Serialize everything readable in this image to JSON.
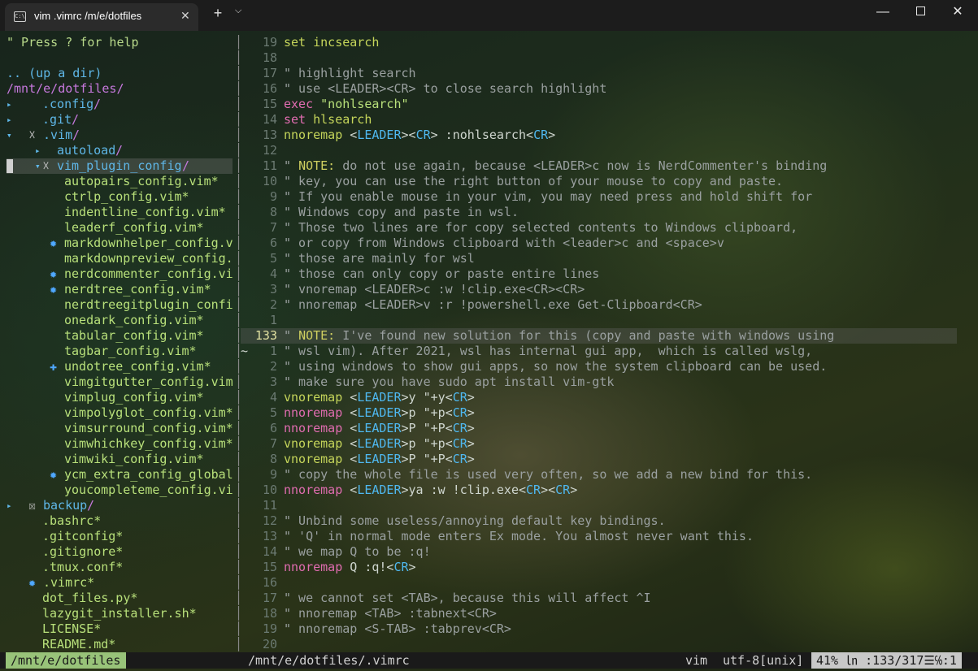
{
  "window": {
    "tab_title": "vim .vimrc /m/e/dotfiles",
    "tab_icon_text": "C:\\",
    "tab_close": "✕",
    "new_tab": "+",
    "dropdown": "⌵",
    "minimize": "—",
    "close": "✕"
  },
  "tree": {
    "help": "\" Press ? for help",
    "updir": ".. (up a dir)",
    "root": "/mnt/e/dotfiles/",
    "rows": [
      {
        "indent": 0,
        "arrow": "▸",
        "mark": "",
        "name": ".config",
        "dir": true
      },
      {
        "indent": 0,
        "arrow": "▸",
        "mark": "",
        "name": ".git",
        "dir": true
      },
      {
        "indent": 0,
        "arrow": "▾",
        "mark": "☓",
        "name": ".vim",
        "dir": true
      },
      {
        "indent": 1,
        "arrow": "▸",
        "mark": "",
        "name": "autoload",
        "dir": true
      },
      {
        "indent": 1,
        "arrow": "▾",
        "mark": "☓",
        "name": "vim_plugin_config",
        "dir": true,
        "selected": true
      },
      {
        "indent": 2,
        "mark": "",
        "name": "autopairs_config.vim*"
      },
      {
        "indent": 2,
        "mark": "",
        "name": "ctrlp_config.vim*"
      },
      {
        "indent": 2,
        "mark": "",
        "name": "indentline_config.vim*"
      },
      {
        "indent": 2,
        "mark": "",
        "name": "leaderf_config.vim*"
      },
      {
        "indent": 2,
        "mark": "✹",
        "name": "markdownhelper_config.v"
      },
      {
        "indent": 2,
        "mark": "",
        "name": "markdownpreview_config."
      },
      {
        "indent": 2,
        "mark": "✹",
        "name": "nerdcommenter_config.vi"
      },
      {
        "indent": 2,
        "mark": "✹",
        "name": "nerdtree_config.vim*"
      },
      {
        "indent": 2,
        "mark": "",
        "name": "nerdtreegitplugin_confi"
      },
      {
        "indent": 2,
        "mark": "",
        "name": "onedark_config.vim*"
      },
      {
        "indent": 2,
        "mark": "",
        "name": "tabular_config.vim*"
      },
      {
        "indent": 2,
        "mark": "",
        "name": "tagbar_config.vim*"
      },
      {
        "indent": 2,
        "mark": "✚",
        "name": "undotree_config.vim*"
      },
      {
        "indent": 2,
        "mark": "",
        "name": "vimgitgutter_config.vim"
      },
      {
        "indent": 2,
        "mark": "",
        "name": "vimplug_config.vim*"
      },
      {
        "indent": 2,
        "mark": "",
        "name": "vimpolyglot_config.vim*"
      },
      {
        "indent": 2,
        "mark": "",
        "name": "vimsurround_config.vim*"
      },
      {
        "indent": 2,
        "mark": "",
        "name": "vimwhichkey_config.vim*"
      },
      {
        "indent": 2,
        "mark": "",
        "name": "vimwiki_config.vim*"
      },
      {
        "indent": 2,
        "mark": "✹",
        "name": "ycm_extra_config_global"
      },
      {
        "indent": 2,
        "mark": "",
        "name": "youcompleteme_config.vi"
      },
      {
        "indent": 0,
        "arrow": "▸",
        "mark": "☒",
        "name": "backup",
        "dir": true
      },
      {
        "indent": 0,
        "mark": "",
        "name": ".bashrc*"
      },
      {
        "indent": 0,
        "mark": "",
        "name": ".gitconfig*"
      },
      {
        "indent": 0,
        "mark": "",
        "name": ".gitignore*"
      },
      {
        "indent": 0,
        "mark": "",
        "name": ".tmux.conf*"
      },
      {
        "indent": 0,
        "mark": "✹",
        "name": ".vimrc*"
      },
      {
        "indent": 0,
        "mark": "",
        "name": "dot_files.py*"
      },
      {
        "indent": 0,
        "mark": "",
        "name": "lazygit_installer.sh*"
      },
      {
        "indent": 0,
        "mark": "",
        "name": "LICENSE*"
      },
      {
        "indent": 0,
        "mark": "",
        "name": "README.md*"
      }
    ]
  },
  "editor": {
    "sign_tilde": "~",
    "lines": [
      {
        "n": "19",
        "tokens": [
          [
            "kw2",
            "set"
          ],
          [
            "plain",
            " "
          ],
          [
            "kw2",
            "incsearch"
          ]
        ]
      },
      {
        "n": "18",
        "tokens": []
      },
      {
        "n": "17",
        "tokens": [
          [
            "cmt",
            "\" highlight search"
          ]
        ]
      },
      {
        "n": "16",
        "tokens": [
          [
            "cmt",
            "\" use <LEADER><CR> to close search highlight"
          ]
        ]
      },
      {
        "n": "15",
        "tokens": [
          [
            "kw",
            "exec"
          ],
          [
            "plain",
            " "
          ],
          [
            "str",
            "\"nohlsearch\""
          ]
        ]
      },
      {
        "n": "14",
        "tokens": [
          [
            "kw",
            "set"
          ],
          [
            "plain",
            " "
          ],
          [
            "kw2",
            "hlsearch"
          ]
        ]
      },
      {
        "n": "13",
        "tokens": [
          [
            "kw2",
            "nnoremap"
          ],
          [
            "plain",
            " <"
          ],
          [
            "key",
            "LEADER"
          ],
          [
            "plain",
            "><"
          ],
          [
            "key",
            "CR"
          ],
          [
            "plain",
            "> :nohlsearch<"
          ],
          [
            "key",
            "CR"
          ],
          [
            "plain",
            ">"
          ]
        ]
      },
      {
        "n": "12",
        "tokens": []
      },
      {
        "n": "11",
        "tokens": [
          [
            "cmt",
            "\" "
          ],
          [
            "cmtnote",
            "NOTE:"
          ],
          [
            "cmt",
            " do not use again, because <LEADER>c now is NerdCommenter's binding"
          ]
        ]
      },
      {
        "n": "10",
        "tokens": [
          [
            "cmt",
            "\" key, you can use the right button of your mouse to copy and paste."
          ]
        ]
      },
      {
        "n": "9",
        "tokens": [
          [
            "cmt",
            "\" If you enable mouse in your vim, you may need press and hold shift for"
          ]
        ]
      },
      {
        "n": "8",
        "tokens": [
          [
            "cmt",
            "\" Windows copy and paste in wsl."
          ]
        ]
      },
      {
        "n": "7",
        "tokens": [
          [
            "cmt",
            "\" Those two lines are for copy selected contents to Windows clipboard,"
          ]
        ]
      },
      {
        "n": "6",
        "tokens": [
          [
            "cmt",
            "\" or copy from Windows clipboard with <leader>c and <space>v"
          ]
        ]
      },
      {
        "n": "5",
        "tokens": [
          [
            "cmt",
            "\" those are mainly for wsl"
          ]
        ]
      },
      {
        "n": "4",
        "tokens": [
          [
            "cmt",
            "\" those can only copy or paste entire lines"
          ]
        ]
      },
      {
        "n": "3",
        "tokens": [
          [
            "cmt",
            "\" vnoremap <LEADER>c :w !clip.exe<CR><CR>"
          ]
        ]
      },
      {
        "n": "2",
        "tokens": [
          [
            "cmt",
            "\" nnoremap <LEADER>v :r !powershell.exe Get-Clipboard<CR>"
          ]
        ]
      },
      {
        "n": "1",
        "tokens": []
      },
      {
        "n": "133",
        "current": true,
        "tokens": [
          [
            "cmt",
            "\" "
          ],
          [
            "cmtnote",
            "NOTE:"
          ],
          [
            "cmt",
            " I've found new solution for this (copy and paste with windows using"
          ]
        ]
      },
      {
        "n": "1",
        "sign": true,
        "tokens": [
          [
            "cmt",
            "\" wsl vim). After 2021, wsl has internal gui app,  which is called wslg,"
          ]
        ]
      },
      {
        "n": "2",
        "tokens": [
          [
            "cmt",
            "\" using windows to show gui apps, so now the system clipboard can be used."
          ]
        ]
      },
      {
        "n": "3",
        "tokens": [
          [
            "cmt",
            "\" make sure you have sudo apt install vim-gtk"
          ]
        ]
      },
      {
        "n": "4",
        "tokens": [
          [
            "kw2",
            "vnoremap"
          ],
          [
            "plain",
            " <"
          ],
          [
            "key",
            "LEADER"
          ],
          [
            "plain",
            ">y \"+y<"
          ],
          [
            "key",
            "CR"
          ],
          [
            "plain",
            ">"
          ]
        ]
      },
      {
        "n": "5",
        "tokens": [
          [
            "kw",
            "nnoremap"
          ],
          [
            "plain",
            " <"
          ],
          [
            "key",
            "LEADER"
          ],
          [
            "plain",
            ">p \"+p<"
          ],
          [
            "key",
            "CR"
          ],
          [
            "plain",
            ">"
          ]
        ]
      },
      {
        "n": "6",
        "tokens": [
          [
            "kw",
            "nnoremap"
          ],
          [
            "plain",
            " <"
          ],
          [
            "key",
            "LEADER"
          ],
          [
            "plain",
            ">P \"+P<"
          ],
          [
            "key",
            "CR"
          ],
          [
            "plain",
            ">"
          ]
        ]
      },
      {
        "n": "7",
        "tokens": [
          [
            "kw2",
            "vnoremap"
          ],
          [
            "plain",
            " <"
          ],
          [
            "key",
            "LEADER"
          ],
          [
            "plain",
            ">p \"+p<"
          ],
          [
            "key",
            "CR"
          ],
          [
            "plain",
            ">"
          ]
        ]
      },
      {
        "n": "8",
        "tokens": [
          [
            "kw2",
            "vnoremap"
          ],
          [
            "plain",
            " <"
          ],
          [
            "key",
            "LEADER"
          ],
          [
            "plain",
            ">P \"+P<"
          ],
          [
            "key",
            "CR"
          ],
          [
            "plain",
            ">"
          ]
        ]
      },
      {
        "n": "9",
        "tokens": [
          [
            "cmt",
            "\" copy the whole file is used very often, so we add a new bind for this."
          ]
        ]
      },
      {
        "n": "10",
        "tokens": [
          [
            "kw",
            "nnoremap"
          ],
          [
            "plain",
            " <"
          ],
          [
            "key",
            "LEADER"
          ],
          [
            "plain",
            ">ya :w !clip.exe<"
          ],
          [
            "key",
            "CR"
          ],
          [
            "plain",
            "><"
          ],
          [
            "key",
            "CR"
          ],
          [
            "plain",
            ">"
          ]
        ]
      },
      {
        "n": "11",
        "tokens": []
      },
      {
        "n": "12",
        "tokens": [
          [
            "cmt",
            "\" Unbind some useless/annoying default key bindings."
          ]
        ]
      },
      {
        "n": "13",
        "tokens": [
          [
            "cmt",
            "\" 'Q' in normal mode enters Ex mode. You almost never want this."
          ]
        ]
      },
      {
        "n": "14",
        "tokens": [
          [
            "cmt",
            "\" we map Q to be :q!"
          ]
        ]
      },
      {
        "n": "15",
        "tokens": [
          [
            "kw",
            "nnoremap"
          ],
          [
            "plain",
            " Q :q!<"
          ],
          [
            "key",
            "CR"
          ],
          [
            "plain",
            ">"
          ]
        ]
      },
      {
        "n": "16",
        "tokens": []
      },
      {
        "n": "17",
        "tokens": [
          [
            "cmt",
            "\" we cannot set <TAB>, because this will affect ^I"
          ]
        ]
      },
      {
        "n": "18",
        "tokens": [
          [
            "cmt",
            "\" nnoremap <TAB> :tabnext<CR>"
          ]
        ]
      },
      {
        "n": "19",
        "tokens": [
          [
            "cmt",
            "\" nnoremap <S-TAB> :tabprev<CR>"
          ]
        ]
      },
      {
        "n": "20",
        "tokens": []
      }
    ]
  },
  "statusline": {
    "left": "/mnt/e/dotfiles",
    "file": "/mnt/e/dotfiles/.vimrc",
    "filetype": "vim",
    "encoding": "utf-8[unix]",
    "position": "41%  ㏑ :133/317☰℅:1"
  }
}
